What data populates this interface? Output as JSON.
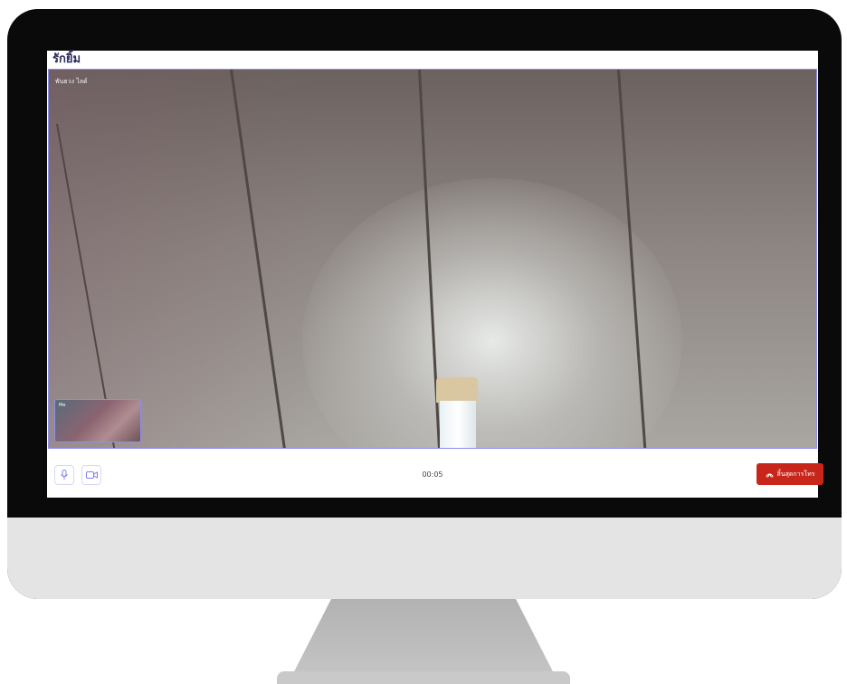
{
  "call": {
    "title": "รักยิ้ม",
    "remote_participant_name": "พันธวง ไลด์",
    "self_view_name": "Me",
    "timer": "00:05",
    "end_call_label": "สิ้นสุดการโทร"
  },
  "controls": {
    "mic_icon": "microphone-icon",
    "camera_icon": "video-camera-icon",
    "end_call_icon": "phone-hangup-icon"
  },
  "colors": {
    "accent": "#7f80f0",
    "end_call": "#c8261b",
    "title": "#2a2a5a"
  }
}
